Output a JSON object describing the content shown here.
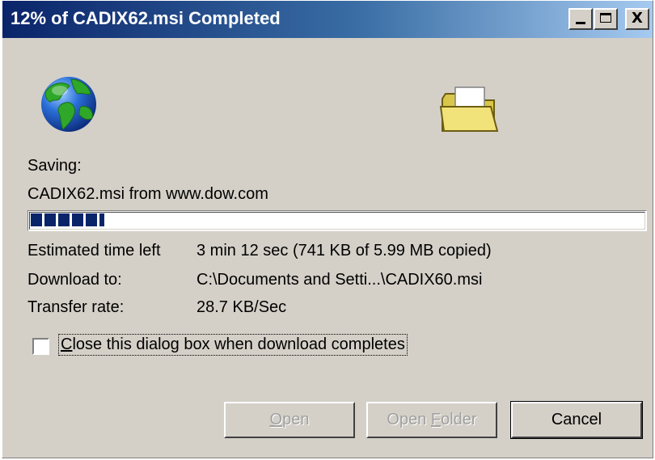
{
  "window": {
    "title": "12% of CADIX62.msi Completed",
    "controls": {
      "minimize": "minimize",
      "maximize": "maximize",
      "close": "X"
    }
  },
  "icons": {
    "globe": "globe-icon",
    "folder": "folder-icon"
  },
  "status": {
    "saving_label": "Saving:",
    "source": "CADIX62.msi from www.dow.com"
  },
  "progress": {
    "percent": 12,
    "color": "#0a246a"
  },
  "details": {
    "estimated_label": "Estimated time left",
    "estimated_value": "3 min 12 sec (741 KB of 5.99 MB copied)",
    "download_to_label": "Download to:",
    "download_to_value": "C:\\Documents and Setti...\\CADIX60.msi",
    "transfer_rate_label": "Transfer rate:",
    "transfer_rate_value": "28.7 KB/Sec"
  },
  "close_on_complete": {
    "checked": false,
    "label_mnemonic": "C",
    "label_rest": "lose this dialog box when download completes"
  },
  "buttons": {
    "open": {
      "mnemonic": "O",
      "rest": "pen",
      "enabled": false
    },
    "open_folder": {
      "pre": "Open ",
      "mnemonic": "F",
      "rest": "older",
      "enabled": false
    },
    "cancel": {
      "label": "Cancel",
      "enabled": true
    }
  }
}
